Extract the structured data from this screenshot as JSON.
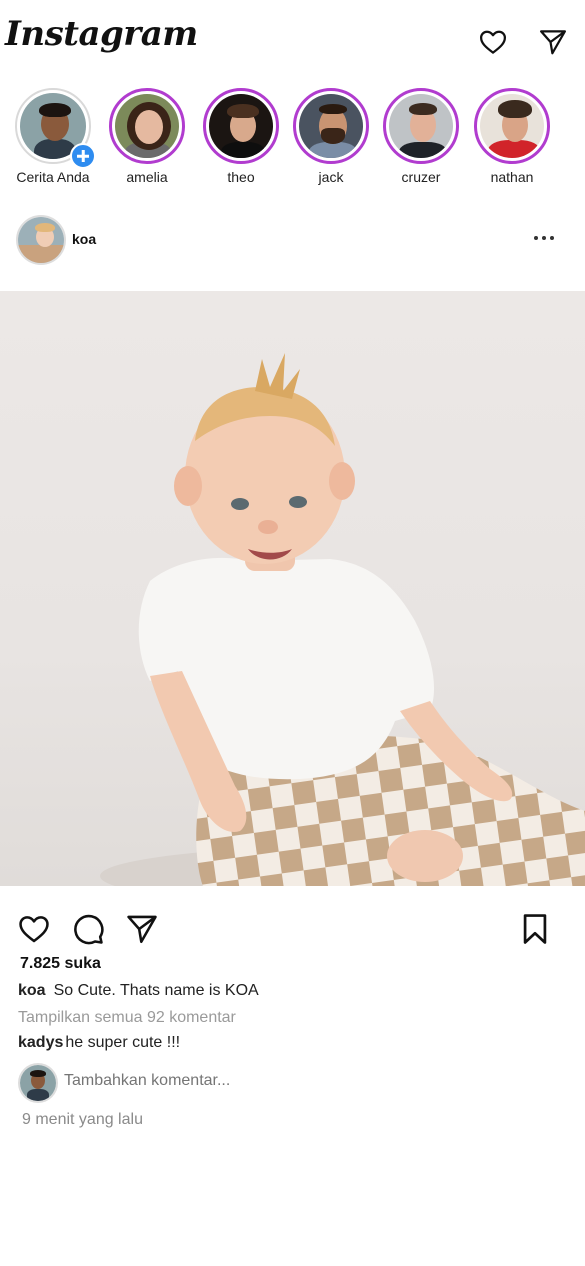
{
  "app": {
    "logo_text": "Instagram"
  },
  "header": {
    "icons": [
      "heart-icon",
      "send-icon"
    ]
  },
  "stories": [
    {
      "name": "Cerita Anda",
      "own": true
    },
    {
      "name": "amelia"
    },
    {
      "name": "theo"
    },
    {
      "name": "jack"
    },
    {
      "name": "cruzer"
    },
    {
      "name": "nathan"
    }
  ],
  "post": {
    "username": "koa",
    "likes": "7.825 suka",
    "caption_user": "koa",
    "caption_text": "So Cute. Thats name is KOA",
    "view_all": "Tampilkan semua 92 komentar",
    "comment_user": "kadys",
    "comment_text": "he super cute !!!",
    "add_placeholder": "Tambahkan komentar...",
    "time": "9 menit yang lalu"
  },
  "colors": {
    "story_ring": "#b13ccf",
    "add_story_badge": "#2e8cf0"
  }
}
